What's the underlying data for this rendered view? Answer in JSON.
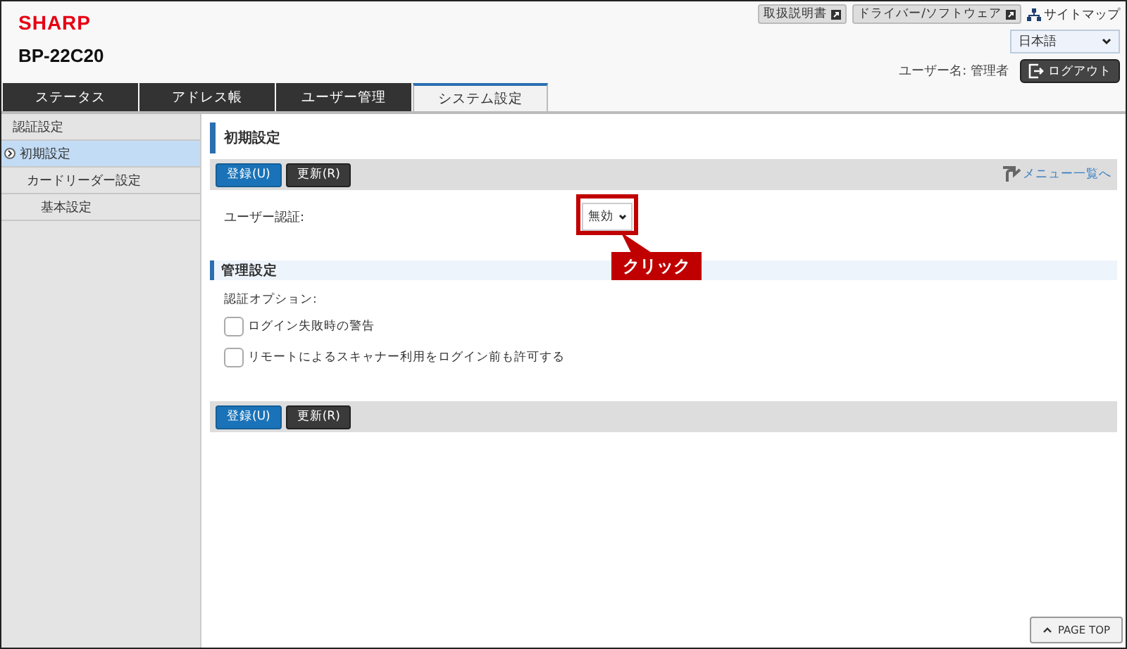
{
  "header": {
    "brand": "SHARP",
    "model": "BP-22C20",
    "links": [
      {
        "label": "取扱説明書",
        "kind": "external"
      },
      {
        "label": "ドライバー/ソフトウェア",
        "kind": "external"
      },
      {
        "label": "サイトマップ",
        "kind": "sitemap"
      }
    ],
    "language": {
      "value": "日本語"
    },
    "user": {
      "label": "ユーザー名:",
      "name": "管理者"
    },
    "logout": "ログアウト"
  },
  "tabs": [
    {
      "label": "ステータス",
      "selected": false
    },
    {
      "label": "アドレス帳",
      "selected": false
    },
    {
      "label": "ユーザー管理",
      "selected": false
    },
    {
      "label": "システム設定",
      "selected": true
    }
  ],
  "sidebar": {
    "items": [
      {
        "label": "認証設定",
        "selected": false,
        "children": [
          {
            "label": "初期設定",
            "selected": true
          },
          {
            "label": "カードリーダー設定",
            "selected": false,
            "children": [
              {
                "label": "基本設定",
                "selected": false
              }
            ]
          }
        ]
      }
    ]
  },
  "page": {
    "title": "初期設定",
    "buttons": [
      {
        "label": "登録(U)",
        "kind": "primary"
      },
      {
        "label": "更新(R)",
        "kind": "secondary"
      }
    ],
    "menu_link": "メニュー一覧へ",
    "user_auth": {
      "label": "ユーザー認証:",
      "value": "無効"
    },
    "section": {
      "title": "管理設定",
      "options_label": "認証オプション:",
      "options": [
        {
          "label": "ログイン失敗時の警告",
          "checked": false
        },
        {
          "label": "リモートによるスキャナー利用をログイン前も許可する",
          "checked": false
        }
      ]
    },
    "bottom_buttons": [
      {
        "label": "登録(U)",
        "kind": "primary"
      },
      {
        "label": "更新(R)",
        "kind": "secondary"
      }
    ],
    "page_top": "PAGE TOP"
  },
  "callout": {
    "text": "クリック"
  }
}
